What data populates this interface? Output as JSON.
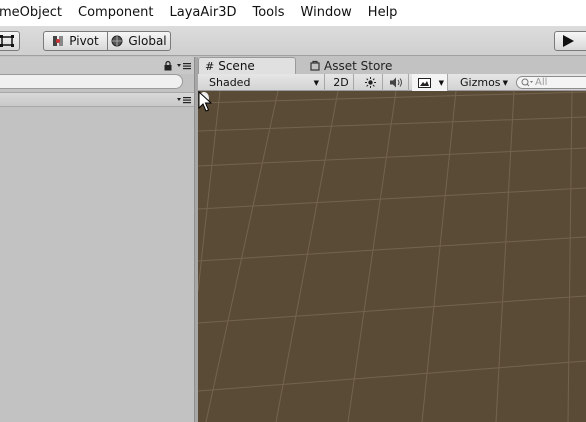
{
  "menubar": {
    "items": [
      "meObject",
      "Component",
      "LayaAir3D",
      "Tools",
      "Window",
      "Help"
    ]
  },
  "toolbar": {
    "pivot_label": "Pivot",
    "global_label": "Global",
    "left_icon": "transform-tool-icon",
    "play_icon": "play-icon"
  },
  "left_panel": {
    "lock_icon": "lock-icon",
    "menu_icon": "panel-menu-icon"
  },
  "tabs": {
    "scene_label": "Scene",
    "asset_store_label": "Asset Store",
    "scene_icon": "grid-icon",
    "store_icon": "bag-icon"
  },
  "scene_toolbar": {
    "shading_mode": "Shaded",
    "mode_2d_label": "2D",
    "lighting_icon": "sun-icon",
    "audio_icon": "speaker-icon",
    "effects_icon": "image-icon",
    "gizmos_label": "Gizmos",
    "search_placeholder": "All"
  },
  "colors": {
    "viewport_background": "#5a4b37",
    "grid_line": "#7a6a55",
    "panel_background": "#c2c2c2"
  }
}
